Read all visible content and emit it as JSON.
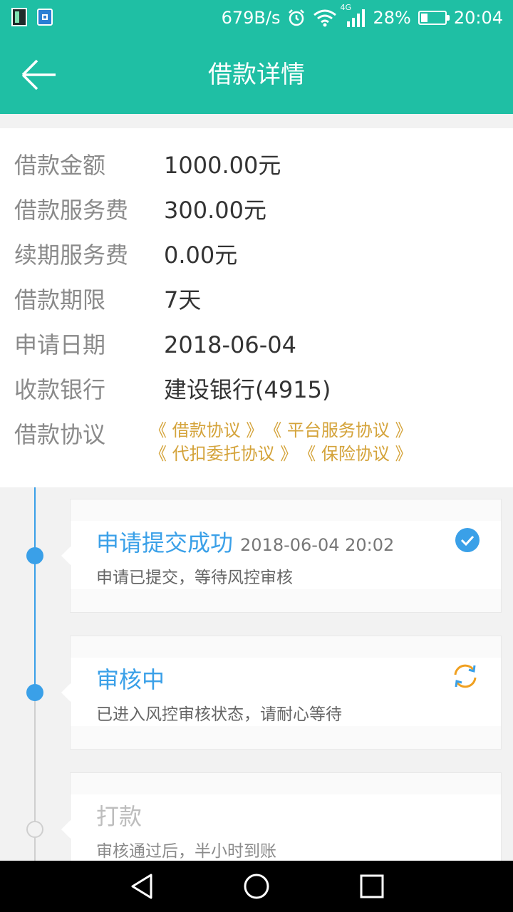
{
  "status_bar": {
    "net_speed": "679B/s",
    "signal_label": "4G",
    "battery_pct": "28%",
    "battery_level": 0.28,
    "time": "20:04",
    "icons": [
      "app-icon",
      "notification-icon",
      "alarm-icon",
      "wifi-icon",
      "signal-icon",
      "battery-icon"
    ]
  },
  "header": {
    "title": "借款详情",
    "back_icon": "back-arrow-icon"
  },
  "details": [
    {
      "label": "借款金额",
      "value": "1000.00元"
    },
    {
      "label": "借款服务费",
      "value": "300.00元"
    },
    {
      "label": "续期服务费",
      "value": "0.00元"
    },
    {
      "label": "借款期限",
      "value": "7天"
    },
    {
      "label": "申请日期",
      "value": "2018-06-04"
    },
    {
      "label": "收款银行",
      "value": "建设银行(4915)"
    }
  ],
  "agreements": {
    "label": "借款协议",
    "links": [
      "《 借款协议 》",
      "《 平台服务协议 》",
      "《 代扣委托协议 》",
      "《 保险协议 》"
    ]
  },
  "timeline": [
    {
      "title": "申请提交成功",
      "time": "2018-06-04 20:02",
      "desc": "申请已提交，等待风控审核",
      "state": "done",
      "icon": "check-icon"
    },
    {
      "title": "审核中",
      "time": "",
      "desc": "已进入风控审核状态，请耐心等待",
      "state": "active",
      "icon": "sync-icon"
    },
    {
      "title": "打款",
      "time": "",
      "desc": "审核通过后，半小时到账",
      "state": "pending",
      "icon": ""
    }
  ],
  "colors": {
    "primary": "#1fbfa4",
    "accent_blue": "#3aa0e8",
    "link_gold": "#d4a33a",
    "sync_orange": "#f0a020"
  },
  "nav": [
    "back-nav-icon",
    "home-nav-icon",
    "recents-nav-icon"
  ]
}
